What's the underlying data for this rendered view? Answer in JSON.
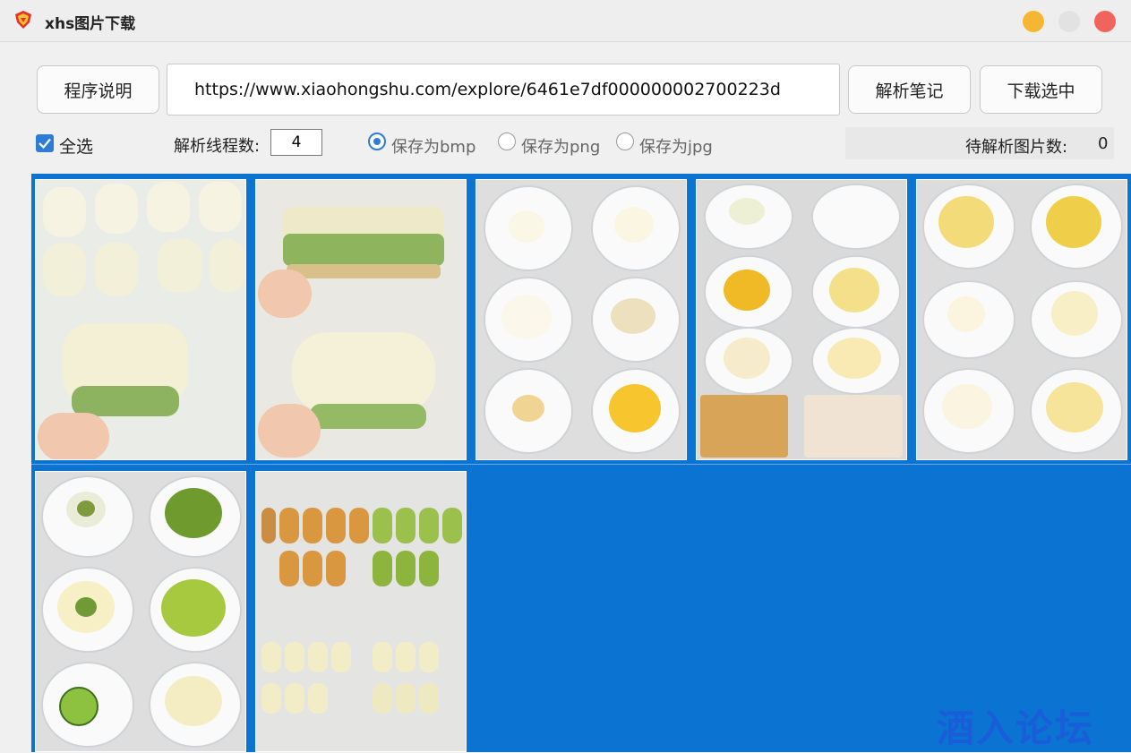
{
  "window": {
    "title": "xhs图片下载"
  },
  "toolbar": {
    "help_label": "程序说明",
    "url_value": "https://www.xiaohongshu.com/explore/6461e7df000000002700223d",
    "parse_label": "解析笔记",
    "download_label": "下载选中"
  },
  "options": {
    "select_all_label": "全选",
    "select_all_checked": true,
    "threads_label": "解析线程数:",
    "threads_value": "4",
    "save_bmp_label": "保存为bmp",
    "save_png_label": "保存为png",
    "save_jpg_label": "保存为jpg",
    "selected_format": "bmp",
    "pending_label": "待解析图片数:",
    "pending_count": "0"
  },
  "colors": {
    "accent": "#2d7cd6",
    "grid_bg": "#0b73d2",
    "watermark": "#1a5dd8"
  },
  "watermark": "酒入论坛"
}
